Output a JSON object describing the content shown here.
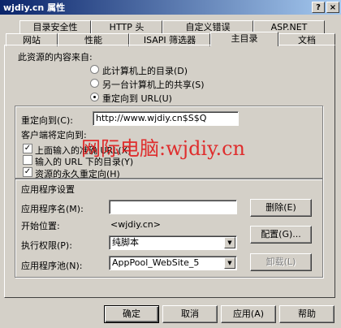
{
  "window": {
    "title": "wjdiy.cn 属性",
    "help_glyph": "?",
    "close_glyph": "×"
  },
  "tabs_row1": [
    "目录安全性",
    "HTTP 头",
    "自定义错误",
    "ASP.NET"
  ],
  "tabs_row2": [
    "网站",
    "性能",
    "ISAPI 筛选器",
    "主目录",
    "文档"
  ],
  "active_tab": "主目录",
  "content_source": {
    "heading": "此资源的内容来自:",
    "options": [
      {
        "label": "此计算机上的目录(D)",
        "selected": false
      },
      {
        "label": "另一台计算机上的共享(S)",
        "selected": false
      },
      {
        "label": "重定向到 URL(U)",
        "selected": true
      }
    ]
  },
  "redirect": {
    "label": "重定向到(C):",
    "value": "http://www.wjdiy.cn$S$Q",
    "client_heading": "客户端将定向到:",
    "checks": [
      {
        "label": "上面输入的准确 URL(X)",
        "checked": true
      },
      {
        "label": "输入的 URL 下的目录(Y)",
        "checked": false
      },
      {
        "label": "资源的永久重定向(H)",
        "checked": true
      }
    ]
  },
  "app_settings": {
    "heading": "应用程序设置",
    "app_name_label": "应用程序名(M):",
    "app_name_value": "",
    "remove_button": "删除(E)",
    "start_label": "开始位置:",
    "start_value": "<wjdiy.cn>",
    "config_button": "配置(G)...",
    "exec_label": "执行权限(P):",
    "exec_value": "纯脚本",
    "pool_label": "应用程序池(N):",
    "pool_value": "AppPool_WebSite_5",
    "unload_button": "卸载(L)"
  },
  "dialog_buttons": {
    "ok": "确定",
    "cancel": "取消",
    "apply": "应用(A)",
    "help": "帮助"
  },
  "watermark": "网际电脑:wjdiy.cn",
  "colors": {
    "face": "#d4d0c8",
    "titlebar": "#0a246a",
    "watermark": "#e02020"
  }
}
